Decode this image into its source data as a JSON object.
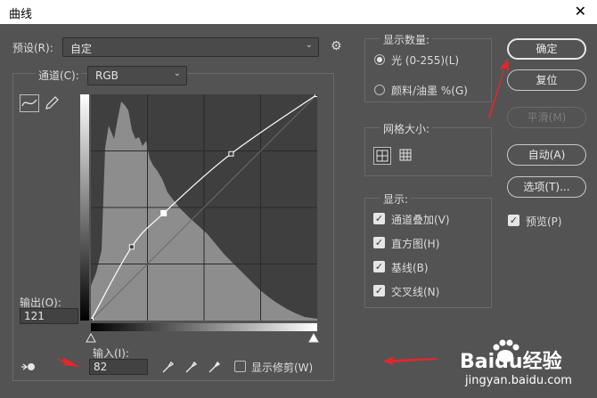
{
  "window": {
    "title": "曲线",
    "close": "✕"
  },
  "preset": {
    "label": "预设(R):",
    "value": "自定"
  },
  "channel": {
    "label": "通道(C):",
    "value": "RGB"
  },
  "output": {
    "label": "输出(O):",
    "value": "121"
  },
  "input": {
    "label": "输入(I):",
    "value": "82"
  },
  "show_amount": {
    "title": "显示数量:",
    "light": "光 (0-255)(L)",
    "pigment": "颜料/油墨 %(G)",
    "selected": "light"
  },
  "grid_size": {
    "title": "网格大小:"
  },
  "show": {
    "title": "显示:",
    "items": [
      {
        "label": "通道叠加(V)",
        "checked": true
      },
      {
        "label": "直方图(H)",
        "checked": true
      },
      {
        "label": "基线(B)",
        "checked": true
      },
      {
        "label": "交叉线(N)",
        "checked": true
      }
    ]
  },
  "buttons": {
    "ok": "确定",
    "reset": "复位",
    "smooth": "平滑(M)",
    "auto": "自动(A)",
    "options": "选项(T)..."
  },
  "preview": {
    "label": "预览(P)",
    "checked": true
  },
  "show_clipping": {
    "label": "显示修剪(W)",
    "checked": false
  },
  "watermark": {
    "text": "Baidu经验",
    "url": "jingyan.baidu.com"
  },
  "curve": {
    "points": [
      [
        0,
        0
      ],
      [
        46,
        83
      ],
      [
        82,
        121
      ],
      [
        158,
        188
      ],
      [
        255,
        255
      ]
    ]
  },
  "colors": {
    "accent_arrow": "#e8262a"
  }
}
